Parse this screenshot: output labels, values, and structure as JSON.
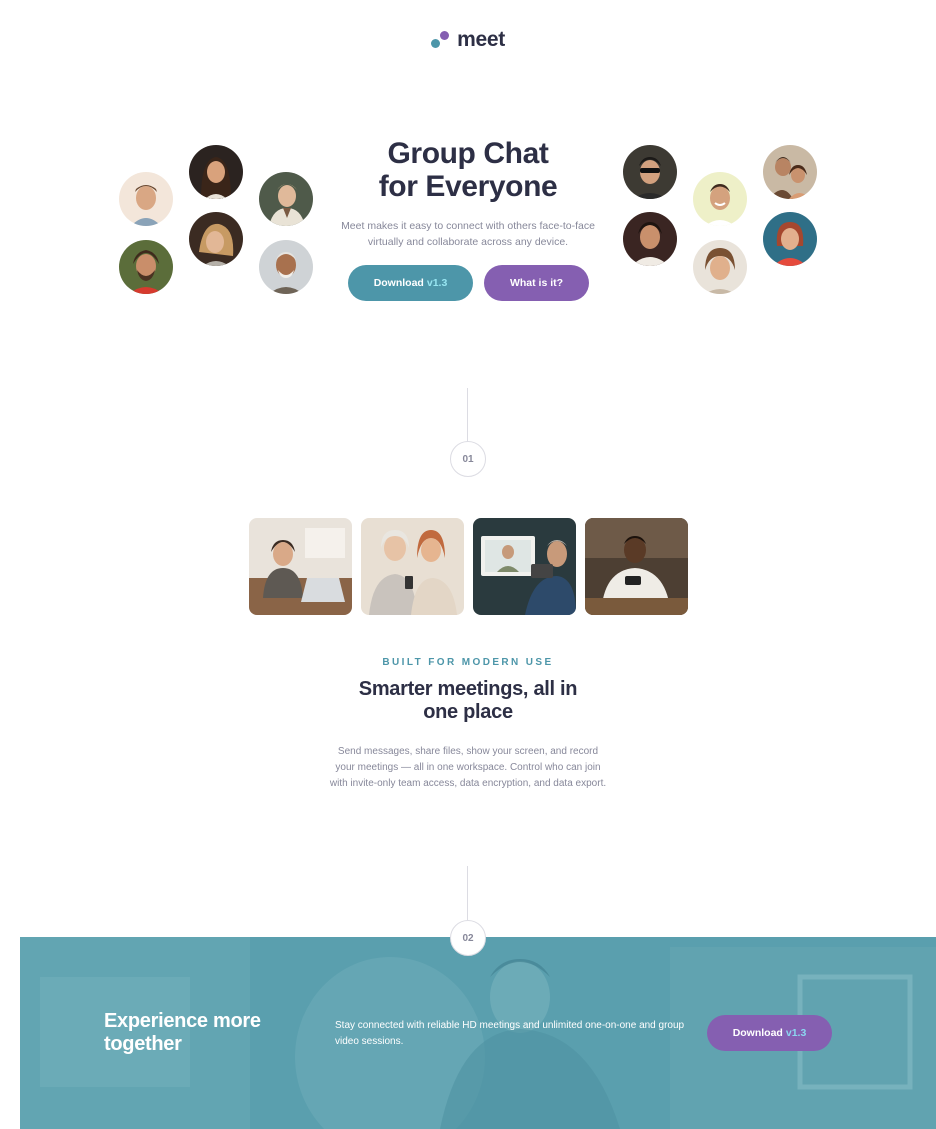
{
  "brand": {
    "name": "meet",
    "colors": {
      "teal": "#4d96a9",
      "purple": "#855fb1",
      "dark": "#2d2f45",
      "muted": "#87889a",
      "band": "#5a9fae"
    }
  },
  "hero": {
    "title_line1": "Group Chat",
    "title_line2": "for Everyone",
    "description": "Meet makes it easy to connect with others face-to-face virtually and collaborate across any device.",
    "download_label": "Download",
    "download_version": "v1.3",
    "what_label": "What is it?"
  },
  "steps": {
    "first": "01",
    "second": "02"
  },
  "features": {
    "eyebrow": "BUILT FOR MODERN USE",
    "title_line1": "Smarter meetings, all in",
    "title_line2": "one place",
    "description": "Send messages, share files, show your screen, and record your meetings — all in one workspace. Control who can join with invite-only team access, data encryption, and data export."
  },
  "cta": {
    "title_line1": "Experience more",
    "title_line2": "together",
    "description": "Stay connected with reliable HD meetings and unlimited one-on-one and group video sessions.",
    "download_label": "Download",
    "download_version": "v1.3"
  }
}
